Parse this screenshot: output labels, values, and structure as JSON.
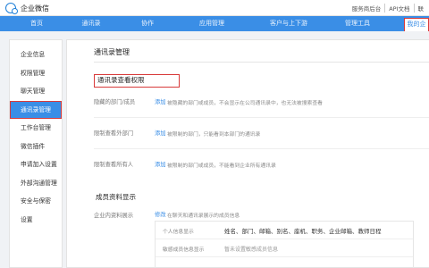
{
  "header": {
    "app_name": "企业微信",
    "links": [
      "服务商后台",
      "API文档",
      "联"
    ]
  },
  "nav": {
    "items": [
      "首页",
      "通讯录",
      "协作",
      "应用管理",
      "客户与上下游",
      "管理工具",
      "我的企"
    ]
  },
  "sidebar": {
    "items": [
      "企业信息",
      "权限管理",
      "聊天管理",
      "通讯录管理",
      "工作台管理",
      "微信插件",
      "申请加入设置",
      "外部沟通管理",
      "安全与保密",
      "设置"
    ]
  },
  "main": {
    "title": "通讯录管理",
    "section1_title": "通讯录查看权限",
    "rows": [
      {
        "label": "隐藏的部门/成员",
        "link": "添加",
        "desc": "被隐藏的部门或成员，不会显示在公司通讯录中，也无法被搜索查看"
      },
      {
        "label": "限制查看外部门",
        "link": "添加",
        "desc": "被限制的部门，只能看到本部门的通讯录"
      },
      {
        "label": "限制查看所有人",
        "link": "添加",
        "desc": "被限制的部门或成员，不能看到企业所有通讯录"
      }
    ],
    "section2_title": "成员资料显示",
    "profile_row": {
      "label": "企业内资料展示",
      "link": "修改",
      "desc": "在聊天和通讯录展示的成员信息"
    },
    "inner": [
      {
        "label": "个人信息显示",
        "value": "姓名、部门、邮箱、别名、座机、职务、企业邮箱、教师日程"
      },
      {
        "label": "敏感成员信息显示",
        "value": "暂未设置敏感成员信息"
      }
    ]
  }
}
